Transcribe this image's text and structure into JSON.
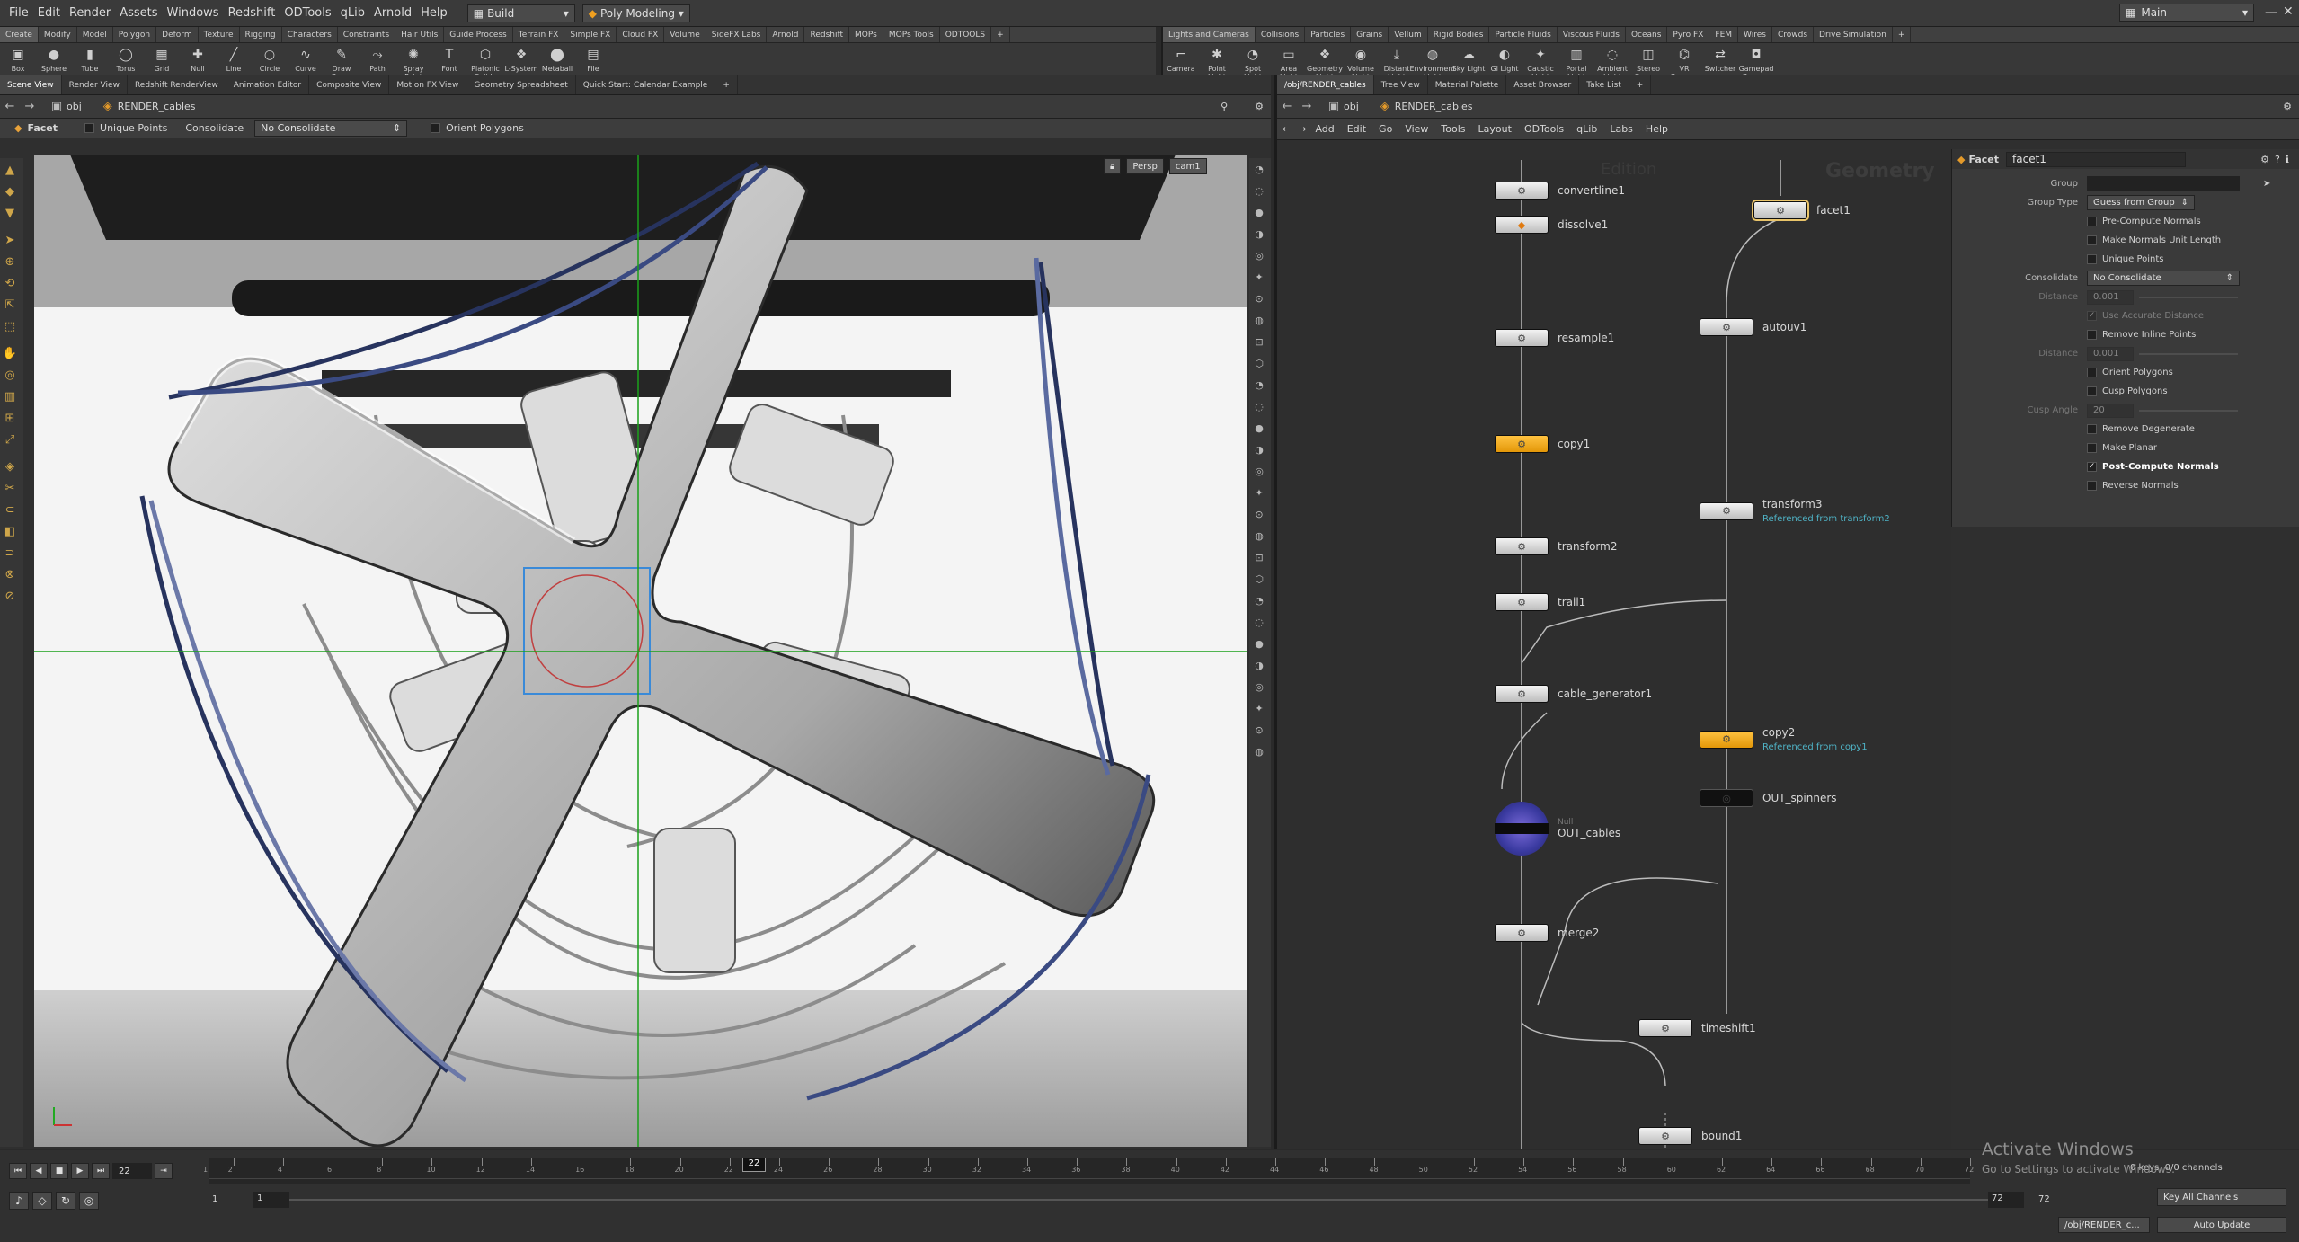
{
  "menubar": {
    "items": [
      "File",
      "Edit",
      "Render",
      "Assets",
      "Windows",
      "Redshift",
      "ODTools",
      "qLib",
      "Arnold",
      "Help"
    ],
    "desktop": "Build",
    "mode": "Poly Modeling",
    "workspace": "Main"
  },
  "shelf_left": {
    "tabs": [
      "Create",
      "Modify",
      "Model",
      "Polygon",
      "Deform",
      "Texture",
      "Rigging",
      "Characters",
      "Constraints",
      "Hair Utils",
      "Guide Process",
      "Terrain FX",
      "Simple FX",
      "Cloud FX",
      "Volume",
      "SideFX Labs",
      "Arnold",
      "Redshift",
      "MOPs",
      "MOPs Tools",
      "ODTOOLS"
    ],
    "tools": [
      "Box",
      "Sphere",
      "Tube",
      "Torus",
      "Grid",
      "Null",
      "Line",
      "Circle",
      "Curve",
      "Draw Curve",
      "Path",
      "Spray Paint",
      "Font",
      "Platonic Solids",
      "L-System",
      "Metaball",
      "File"
    ]
  },
  "shelf_right": {
    "tabs": [
      "Lights and Cameras",
      "Collisions",
      "Particles",
      "Grains",
      "Vellum",
      "Rigid Bodies",
      "Particle Fluids",
      "Viscous Fluids",
      "Oceans",
      "Pyro FX",
      "FEM",
      "Wires",
      "Crowds",
      "Drive Simulation"
    ],
    "tools": [
      "Camera",
      "Point Light",
      "Spot Light",
      "Area Light",
      "Geometry Light",
      "Volume Light",
      "Distant Light",
      "Environment Light",
      "Sky Light",
      "GI Light",
      "Caustic Light",
      "Portal Light",
      "Ambient Light",
      "Stereo Camera",
      "VR Camera",
      "Switcher",
      "Gamepad Camera"
    ]
  },
  "left_pane": {
    "tabs": [
      "Scene View",
      "Render View",
      "Redshift RenderView",
      "Animation Editor",
      "Composite View",
      "Motion FX View",
      "Geometry Spreadsheet",
      "Quick Start: Calendar Example"
    ],
    "path": [
      "obj",
      "RENDER_cables"
    ],
    "opbar": {
      "op": "Facet",
      "unique": "Unique Points",
      "consolidate": "Consolidate",
      "consolidate_val": "No Consolidate",
      "orient": "Orient Polygons"
    },
    "viewport": {
      "persp": "Persp",
      "cam": "cam1"
    }
  },
  "right_pane": {
    "tabs": [
      "/obj/RENDER_cables",
      "Tree View",
      "Material Palette",
      "Asset Browser",
      "Take List"
    ],
    "path": [
      "obj",
      "RENDER_cables"
    ],
    "menu": [
      "Add",
      "Edit",
      "Go",
      "View",
      "Tools",
      "Layout",
      "ODTools",
      "qLib",
      "Labs",
      "Help"
    ],
    "network_label": "Geometry",
    "watermark": "Edition"
  },
  "nodes": {
    "convertline1": "convertline1",
    "dissolve1": "dissolve1",
    "resample1": "resample1",
    "copy1": "copy1",
    "transform2": "transform2",
    "trail1": "trail1",
    "cable_generator1": "cable_generator1",
    "out_cables": "OUT_cables",
    "null_tag": "Null",
    "merge2": "merge2",
    "timeshift1": "timeshift1",
    "bound1": "bound1",
    "facet1": "facet1",
    "autouv1": "autouv1",
    "transform3": "transform3",
    "transform3_ref": "Referenced from transform2",
    "copy2": "copy2",
    "copy2_ref": "Referenced from copy1",
    "out_spinners": "OUT_spinners"
  },
  "params": {
    "op_type": "Facet",
    "op_name": "facet1",
    "group_label": "Group",
    "group_type_label": "Group Type",
    "group_type_val": "Guess from Group",
    "pre_compute": "Pre-Compute Normals",
    "make_unit": "Make Normals Unit Length",
    "unique_points": "Unique Points",
    "consolidate_label": "Consolidate",
    "consolidate_val": "No Consolidate",
    "distance_label": "Distance",
    "distance_val": "0.001",
    "accurate": "Use Accurate Distance",
    "remove_inline": "Remove Inline Points",
    "distance2_label": "Distance",
    "distance2_val": "0.001",
    "orient": "Orient Polygons",
    "cusp": "Cusp Polygons",
    "cusp_angle_label": "Cusp Angle",
    "cusp_angle_val": "20",
    "remove_degenerate": "Remove Degenerate",
    "make_planar": "Make Planar",
    "post_compute": "Post-Compute Normals",
    "reverse": "Reverse Normals"
  },
  "timeline": {
    "frame": "22",
    "start": "1",
    "start2": "1",
    "end": "72",
    "end2": "72",
    "ticks": [
      "1",
      "2",
      "4",
      "6",
      "8",
      "10",
      "12",
      "14",
      "16",
      "18",
      "20",
      "22",
      "24",
      "26",
      "28",
      "30",
      "32",
      "34",
      "36",
      "38",
      "40",
      "42",
      "44",
      "46",
      "48",
      "50",
      "52",
      "54",
      "56",
      "58",
      "60",
      "62",
      "64",
      "66",
      "68",
      "70",
      "72"
    ],
    "keys": "0 keys, 0/0 channels",
    "key_all": "Key All Channels",
    "auto_update": "Auto Update",
    "path": "/obj/RENDER_c..."
  },
  "activate": {
    "title": "Activate Windows",
    "sub": "Go to Settings to activate Windows."
  }
}
